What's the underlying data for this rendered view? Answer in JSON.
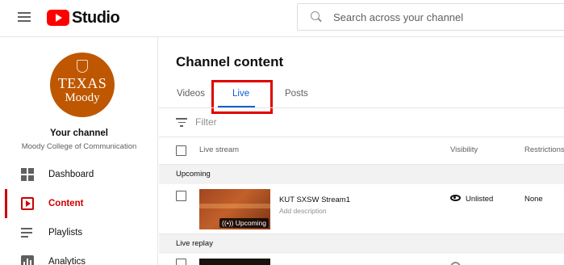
{
  "header": {
    "app_name": "Studio",
    "search_placeholder": "Search across your channel"
  },
  "sidebar": {
    "avatar_line1": "TEXAS",
    "avatar_line2": "Moody",
    "channel_title": "Your channel",
    "channel_name": "Moody College of Communication",
    "items": [
      {
        "label": "Dashboard",
        "icon": "dashboard-icon"
      },
      {
        "label": "Content",
        "icon": "content-icon",
        "active": true
      },
      {
        "label": "Playlists",
        "icon": "playlists-icon"
      },
      {
        "label": "Analytics",
        "icon": "analytics-icon"
      }
    ]
  },
  "main": {
    "title": "Channel content",
    "tabs": [
      {
        "label": "Videos"
      },
      {
        "label": "Live",
        "active": true
      },
      {
        "label": "Posts"
      }
    ],
    "filter_placeholder": "Filter",
    "columns": [
      "Live stream",
      "Visibility",
      "Restrictions"
    ],
    "sections": [
      {
        "label": "Upcoming",
        "rows": [
          {
            "title": "KUT SXSW Stream1",
            "description": "Add description",
            "badge": "Upcoming",
            "visibility": "Unlisted",
            "restrictions": "None"
          }
        ]
      },
      {
        "label": "Live replay",
        "rows": []
      }
    ]
  },
  "colors": {
    "accent_red": "#cc0000",
    "tab_blue": "#065fd4",
    "avatar_orange": "#bf5700",
    "highlight_red": "#e00000"
  }
}
